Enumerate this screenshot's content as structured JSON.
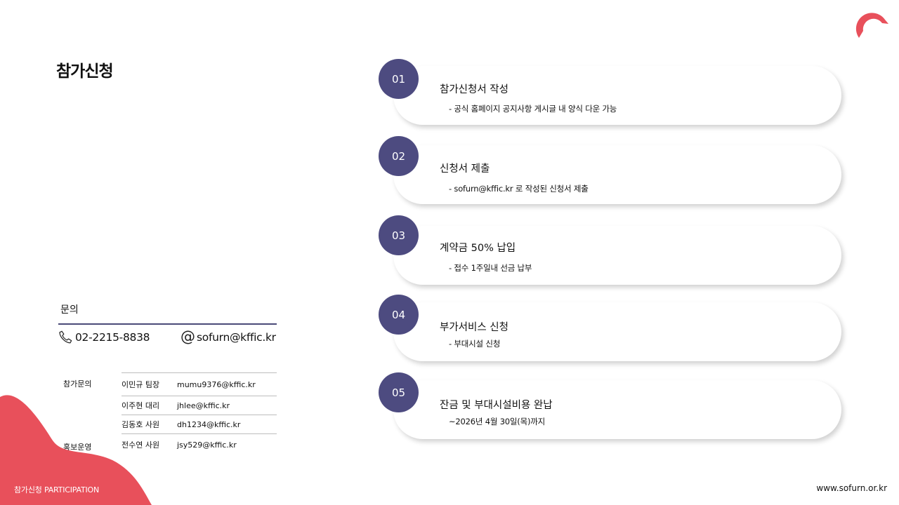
{
  "page_title": "참가신청",
  "contact": {
    "heading": "문의",
    "phone": "02-2215-8838",
    "email": "sofurn@kffic.kr",
    "categories": [
      "참가문의",
      "홍보운영"
    ],
    "staff": [
      {
        "name": "이민규 팀장",
        "email": "mumu9376@kffic.kr"
      },
      {
        "name": "이주현 대리",
        "email": "jhlee@kffic.kr"
      },
      {
        "name": "김동호 사원",
        "email": "dh1234@kffic.kr"
      },
      {
        "name": "전수연 사원",
        "email": "jsy529@kffic.kr"
      }
    ]
  },
  "steps": [
    {
      "number": "01",
      "title": "참가신청서 작성",
      "desc": "- 공식 홈페이지 공지사항 게시글 내 양식 다운 가능"
    },
    {
      "number": "02",
      "title": "신청서 제출",
      "desc": "- sofurn@kffic.kr 로 작성된 신청서 제출"
    },
    {
      "number": "03",
      "title": "계약금 50% 납입",
      "desc": "- 접수 1주일내 선금 납부"
    },
    {
      "number": "04",
      "title": "부가서비스 신청",
      "desc": "- 부대시설 신청"
    },
    {
      "number": "05",
      "title": "잔금 및 부대시설비용 완납",
      "desc": "~2026년 4월 30일(목)까지"
    }
  ],
  "footer": {
    "left": "참가신청 PARTICIPATION",
    "right": "www.sofurn.or.kr"
  },
  "colors": {
    "accent_red": "#e8505b",
    "step_circle": "#4d4b80",
    "rule": "#4a4a78"
  },
  "icons": {
    "logo": "brand-logo-icon",
    "phone": "phone-icon",
    "email": "at-sign-icon"
  }
}
